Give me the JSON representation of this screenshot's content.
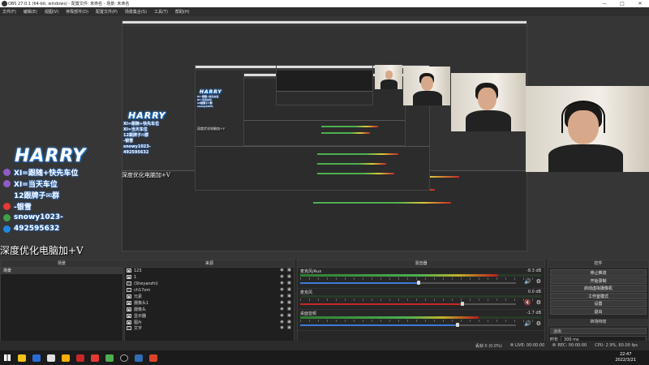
{
  "window": {
    "title": "OBS 27.0.1 (64-bit, windows) - 配置文件: 未命名 - 场景: 未命名",
    "minimize": "—",
    "maximize": "□",
    "close": "✕"
  },
  "menu": [
    "文件(F)",
    "编辑(E)",
    "视图(V)",
    "停靠部件(D)",
    "配置文件(P)",
    "场景集合(S)",
    "工具(T)",
    "帮助(H)"
  ],
  "overlay": {
    "logo": "HARRY",
    "lines": [
      "XI=跟随+快先车位",
      "XI=当天车位",
      "12跟牌子✉群",
      "-银雪",
      "snowy1023-",
      "492595632"
    ],
    "watermark": "深度优化电脑加+V"
  },
  "docks": {
    "scenes": {
      "title": "场景",
      "items": [
        "场景"
      ],
      "footer": [
        "+",
        "−",
        "∧",
        "∨"
      ]
    },
    "sources": {
      "title": "来源",
      "items": [
        {
          "icon": "▣",
          "name": "123"
        },
        {
          "icon": "▣",
          "name": "1"
        },
        {
          "icon": "T",
          "name": "(Sheyanzhi)"
        },
        {
          "icon": "T",
          "name": "ch17om"
        },
        {
          "icon": "▣",
          "name": "元素"
        },
        {
          "icon": "▣",
          "name": "摄像头1"
        },
        {
          "icon": "▣",
          "name": "摄像头"
        },
        {
          "icon": "▣",
          "name": "显示器"
        },
        {
          "icon": "▣",
          "name": "图片"
        },
        {
          "icon": "T",
          "name": "文字"
        }
      ],
      "footer": [
        "+",
        "−",
        "⚙",
        "∧",
        "∨"
      ]
    },
    "mixer": {
      "title": "混音器",
      "channels": [
        {
          "name": "麦克风/Aux",
          "db": "-8.3 dB",
          "level": 0.82,
          "volume": 0.55
        },
        {
          "name": "麦克风",
          "db": "0.0 dB",
          "level": 0.0,
          "volume": 0.75
        },
        {
          "name": "桌面音频",
          "db": "-1.7 dB",
          "level": 0.74,
          "volume": 0.73
        }
      ]
    },
    "transitions": {
      "title": "转场特效",
      "transition": "淡出",
      "duration_label": "时长",
      "duration": "300 ms"
    },
    "controls": {
      "title": "控件",
      "buttons": [
        "停止推流",
        "开始录制",
        "启动虚拟摄像机",
        "工作室模式",
        "设置",
        "退出"
      ]
    }
  },
  "status": {
    "dropped": "丢帧 0 (0.0%)",
    "live": "LIVE: 00:00:00",
    "rec": "REC: 00:00:00",
    "cpu": "CPU: 2.9%, 60.00 fps"
  },
  "taskbar": {
    "time": "22:47",
    "date": "2022/3/21",
    "apps": [
      "#f0c419",
      "#2b6bd6",
      "#e0e0e0",
      "#ffb000",
      "#c62828",
      "#e53935",
      "#4caf50",
      "#111111",
      "#2f6db4",
      "#d8442b"
    ]
  }
}
